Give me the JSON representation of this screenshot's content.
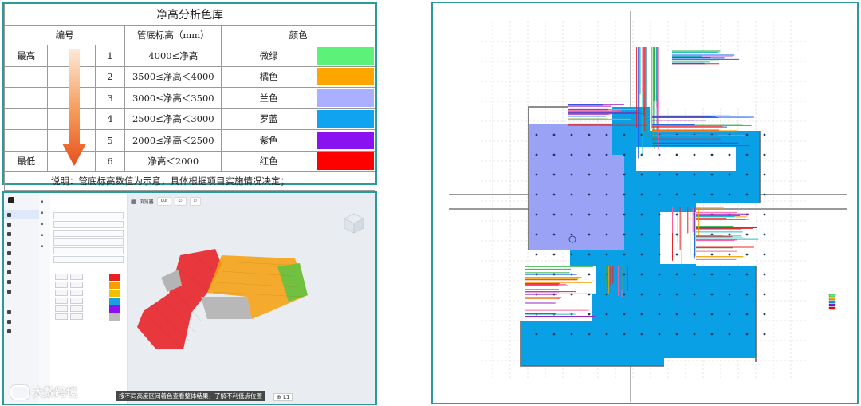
{
  "legend": {
    "title": "净高分析色库",
    "headers": {
      "number": "编号",
      "elevation": "管底标高（mm）",
      "color": "颜色"
    },
    "rows": [
      {
        "rank": "最高",
        "no": "1",
        "range": "4000≤净高",
        "name": "微绿",
        "hex": "#5cf27a"
      },
      {
        "rank": "",
        "no": "2",
        "range": "3500≤净高＜4000",
        "name": "橘色",
        "hex": "#ffa500"
      },
      {
        "rank": "",
        "no": "3",
        "range": "3000≤净高＜3500",
        "name": "兰色",
        "hex": "#aab0ff"
      },
      {
        "rank": "",
        "no": "4",
        "range": "2500≤净高＜3000",
        "name": "罗蓝",
        "hex": "#0fa3f0"
      },
      {
        "rank": "",
        "no": "5",
        "range": "2000≤净高＜2500",
        "name": "紫色",
        "hex": "#8a12f0"
      },
      {
        "rank": "最低",
        "no": "6",
        "range": "净高＜2000",
        "name": "红色",
        "hex": "#ff0000"
      }
    ],
    "note": "说明：管底标高数值为示意，具体根据项目实施情况决定；"
  },
  "app": {
    "toolbar_title": "浏览器",
    "toolbar_buttons": [
      "Cut",
      "∅",
      "∅"
    ],
    "tooltip": "按不同高度区间着色查看整体结果，了解不利低点位置",
    "level": "L1",
    "watermark": "大数跨境",
    "legend_swatches": [
      "#e82020",
      "#f5a000",
      "#f0c000",
      "#1aa0e0",
      "#8a12f0",
      "#bbbbbb"
    ]
  },
  "plan": {
    "colors": {
      "lavender": "#9aa2f5",
      "blue": "#0aa0e6"
    }
  }
}
